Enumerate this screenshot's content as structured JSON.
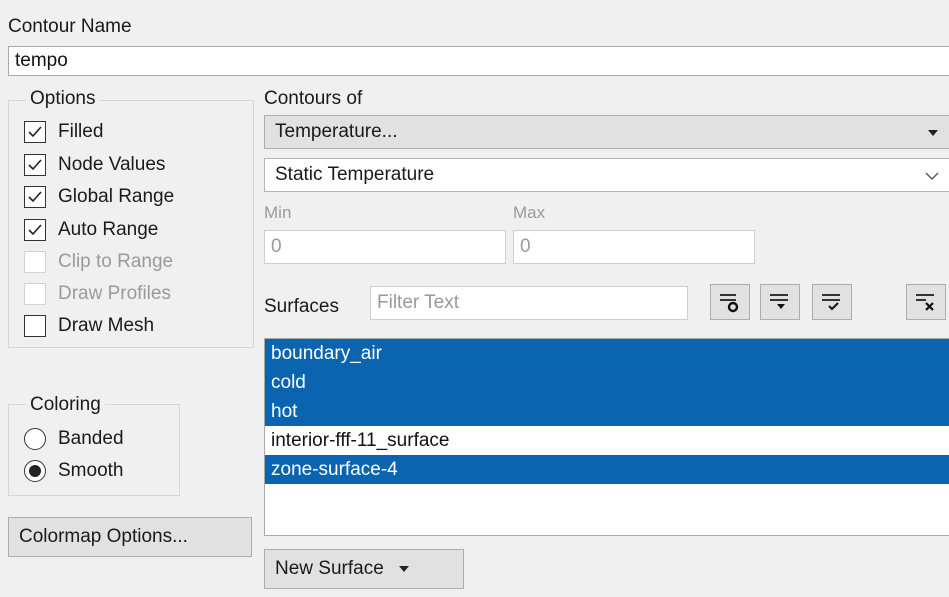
{
  "contour_name": {
    "label": "Contour Name",
    "value": "tempo"
  },
  "options": {
    "title": "Options",
    "items": [
      {
        "label": "Filled",
        "checked": true,
        "enabled": true
      },
      {
        "label": "Node Values",
        "checked": true,
        "enabled": true
      },
      {
        "label": "Global Range",
        "checked": true,
        "enabled": true
      },
      {
        "label": "Auto Range",
        "checked": true,
        "enabled": true
      },
      {
        "label": "Clip to Range",
        "checked": false,
        "enabled": false
      },
      {
        "label": "Draw Profiles",
        "checked": false,
        "enabled": false
      },
      {
        "label": "Draw Mesh",
        "checked": false,
        "enabled": true
      }
    ]
  },
  "coloring": {
    "title": "Coloring",
    "options": [
      {
        "label": "Banded",
        "selected": false
      },
      {
        "label": "Smooth",
        "selected": true
      }
    ]
  },
  "colormap_button": "Colormap Options...",
  "contours_of": {
    "label": "Contours of",
    "category": "Temperature...",
    "variable": "Static Temperature"
  },
  "range": {
    "min_label": "Min",
    "min_value": "0",
    "max_label": "Max",
    "max_value": "0"
  },
  "surfaces": {
    "label": "Surfaces",
    "filter_placeholder": "Filter Text",
    "items": [
      {
        "name": "boundary_air",
        "selected": true
      },
      {
        "name": "cold",
        "selected": true
      },
      {
        "name": "hot",
        "selected": true
      },
      {
        "name": "interior-fff-11_surface",
        "selected": false
      },
      {
        "name": "zone-surface-4",
        "selected": true
      }
    ]
  },
  "new_surface_button": "New Surface",
  "colors": {
    "selection": "#0a64b0",
    "background": "#f0f0f0"
  }
}
